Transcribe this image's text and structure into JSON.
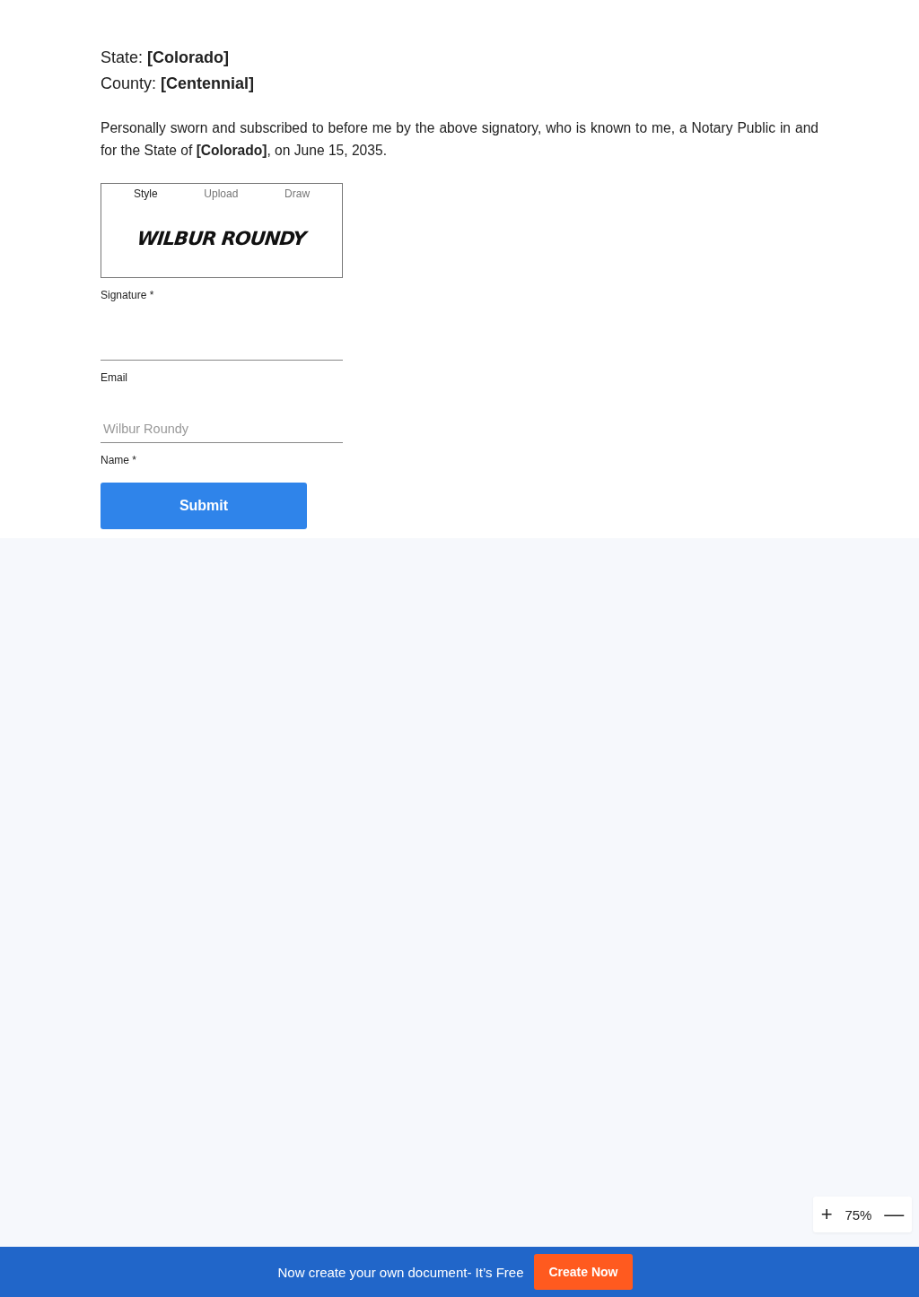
{
  "header_lines": [
    "State: **[Colorado]**",
    "County: **[Centennial]**"
  ],
  "paragraph": "Personally sworn and subscribed to before me by the above signatory, who is known to me, a Notary Public in and for the State of **[Colorado]**, on June 15, 2035.",
  "signature_pad": {
    "tabs": [
      {
        "label": "Style",
        "selected": true
      },
      {
        "label": "Upload",
        "selected": false
      },
      {
        "label": "Draw",
        "selected": false
      }
    ],
    "signature": "WILBUR ROUNDY",
    "label": "Signature *"
  },
  "fields": [
    {
      "label": "Email"
    },
    {
      "label": "Name *",
      "placeholder": "Wilbur Roundy"
    }
  ],
  "submit_button": "Submit",
  "zoom": {
    "zoom_in": "+",
    "level_text": "75%",
    "zoom_out": "—"
  },
  "banner": {
    "text": "Now create your own document- It’s Free",
    "button": "Create Now"
  }
}
